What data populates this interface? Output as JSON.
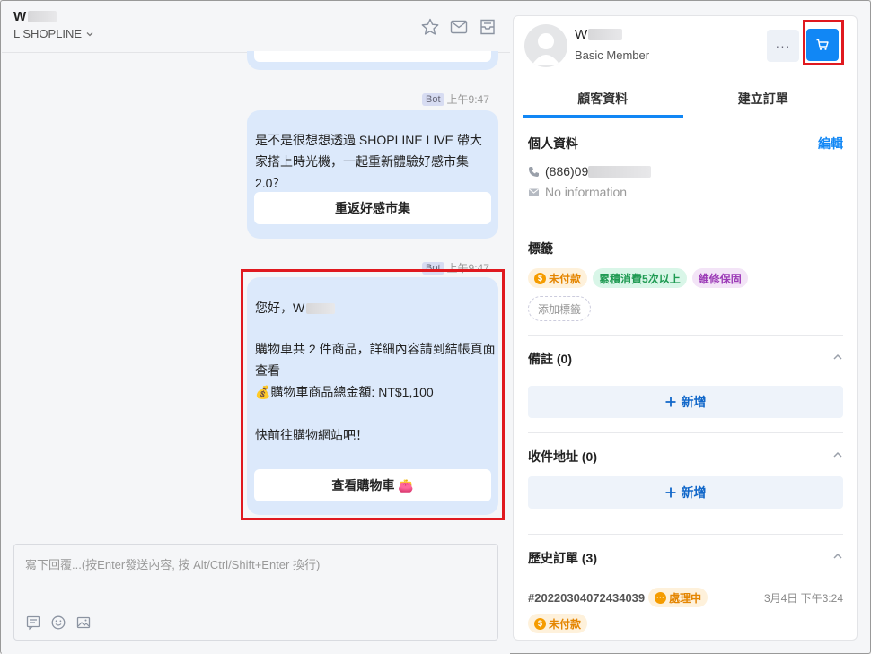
{
  "chat": {
    "name_initial": "W",
    "channel": "L SHOPLINE",
    "messages": [
      {
        "bot_tag": "Bot",
        "time": "上午9:47",
        "text": "是不是很想想透過 SHOPLINE LIVE 帶大家搭上時光機，一起重新體驗好感市集 2.0？",
        "button": "重返好感市集"
      },
      {
        "bot_tag": "Bot",
        "time": "上午9:47",
        "greeting": "您好，W",
        "line1": "購物車共 2 件商品，詳細內容請到結帳頁面查看",
        "line2": "💰購物車商品總金額: NT$1,100",
        "line3": "快前往購物網站吧！",
        "button": "查看購物車 👛"
      }
    ],
    "composer_placeholder": "寫下回覆...(按Enter發送內容, 按 Alt/Ctrl/Shift+Enter 換行)",
    "composer_tools": [
      "note-icon",
      "emoji-icon",
      "image-icon"
    ]
  },
  "customer": {
    "name_initial": "W",
    "level": "Basic Member",
    "more_label": "···",
    "tabs": [
      "顧客資料",
      "建立訂單"
    ],
    "personal": {
      "title": "個人資料",
      "edit": "編輯",
      "phone_prefix": "(886)09",
      "email": "No information"
    },
    "tags": {
      "title": "標籤",
      "items": [
        "未付款",
        "累積消費5次以上",
        "維修保固"
      ],
      "add": "添加標籤"
    },
    "notes": {
      "title": "備註 (0)",
      "add": "新增"
    },
    "addresses": {
      "title": "收件地址 (0)",
      "add": "新增"
    },
    "orders": {
      "title": "歷史訂單 (3)",
      "order_no": "#20220304072434039",
      "status": "處理中",
      "time": "3月4日 下午3:24",
      "payment": "未付款"
    }
  },
  "colors": {
    "accent": "#1187f5",
    "highlight": "#e0191f",
    "bubble": "#dce9fb"
  }
}
